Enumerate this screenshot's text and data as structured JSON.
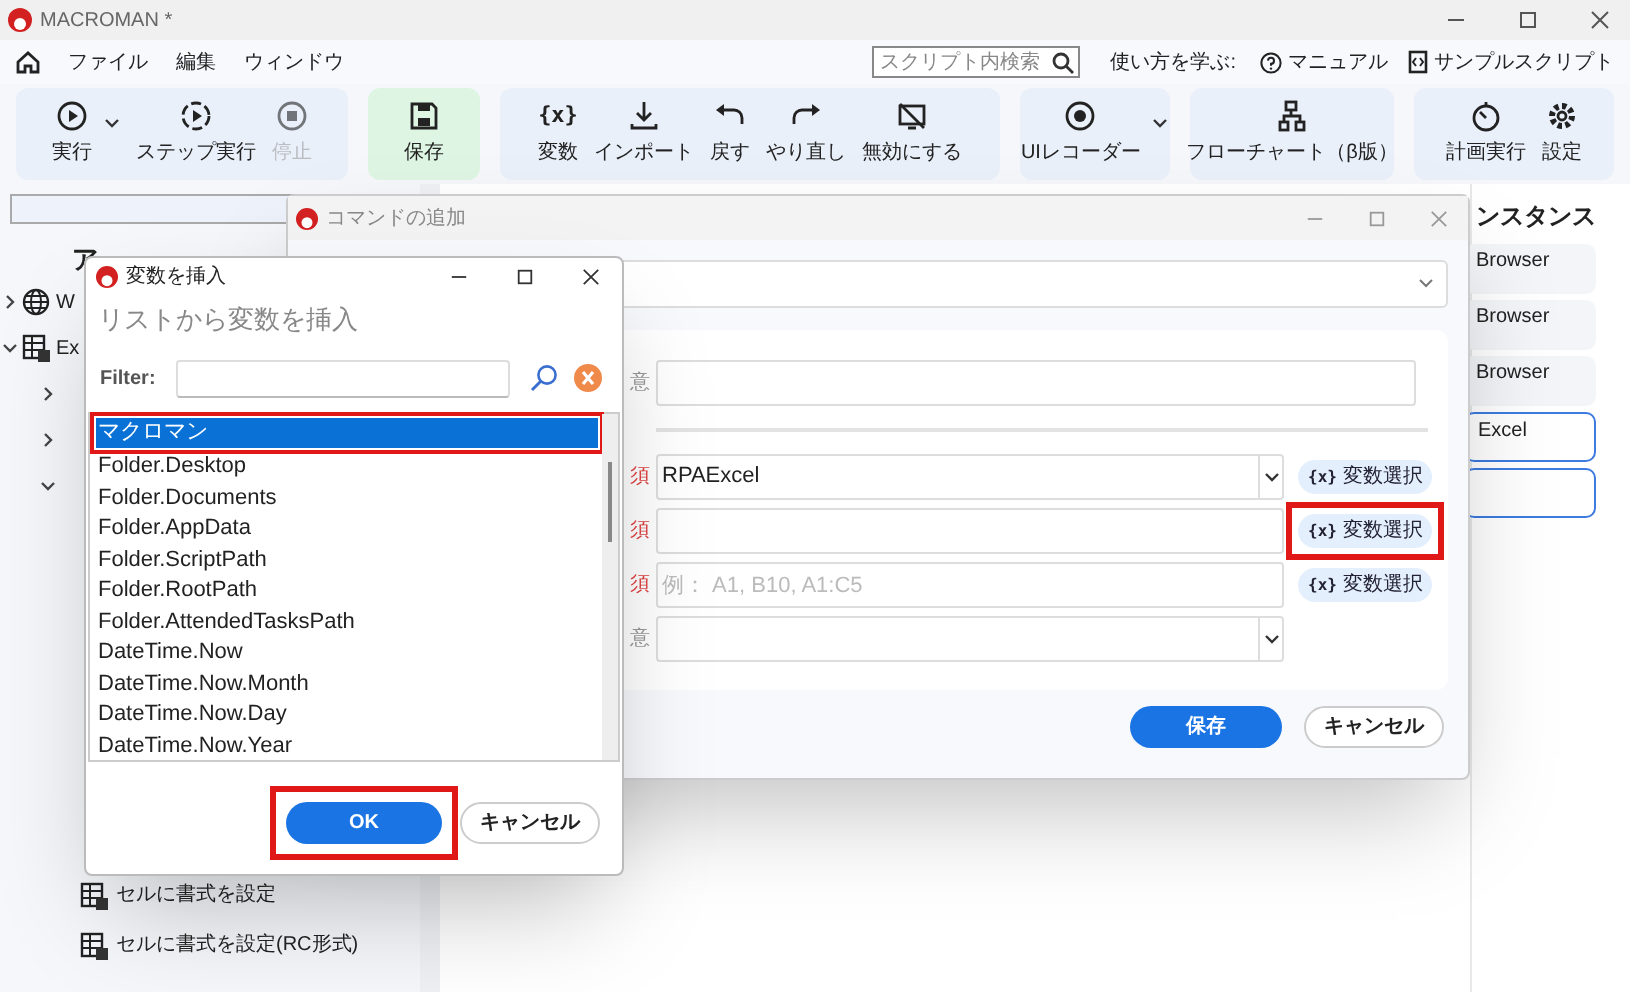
{
  "app": {
    "title": "MACROMAN *"
  },
  "menu": [
    {
      "label": "ファイル"
    },
    {
      "label": "編集"
    },
    {
      "label": "ウィンドウ"
    }
  ],
  "search": {
    "placeholder": "スクリプト内検索"
  },
  "learn": {
    "label": "使い方を学ぶ:",
    "links": [
      {
        "label": "マニュアル"
      },
      {
        "label": "サンプルスクリプト"
      }
    ]
  },
  "toolbar": [
    {
      "kind": "plain",
      "buttons": [
        {
          "label": "実行",
          "dropdown": true,
          "disabled": false
        },
        {
          "label": "ステップ実行",
          "dropdown": false,
          "disabled": false
        },
        {
          "label": "停止",
          "dropdown": false,
          "disabled": true
        }
      ]
    },
    {
      "kind": "accent",
      "buttons": [
        {
          "label": "保存",
          "dropdown": false,
          "disabled": false
        }
      ]
    },
    {
      "kind": "plain",
      "buttons": [
        {
          "label": "変数",
          "glyph": "{x}",
          "dropdown": false,
          "disabled": false
        },
        {
          "label": "インポート",
          "dropdown": false,
          "disabled": false
        },
        {
          "label": "戻す",
          "dropdown": false,
          "disabled": false
        },
        {
          "label": "やり直し",
          "dropdown": false,
          "disabled": false
        },
        {
          "label": "無効にする",
          "dropdown": false,
          "disabled": false
        }
      ]
    },
    {
      "kind": "plain",
      "buttons": [
        {
          "label": "UIレコーダー",
          "dropdown": true,
          "disabled": false
        }
      ]
    },
    {
      "kind": "plain",
      "buttons": [
        {
          "label": "フローチャート（β版）",
          "dropdown": false,
          "disabled": false
        }
      ]
    },
    {
      "kind": "plain",
      "buttons": [
        {
          "label": "計画実行",
          "dropdown": false,
          "disabled": false
        },
        {
          "label": "設定",
          "dropdown": false,
          "disabled": false
        }
      ]
    }
  ],
  "side_panel": {
    "header": "ア",
    "tree": [
      {
        "label": "W",
        "kind": "web",
        "expanded": false
      },
      {
        "label": "Ex",
        "kind": "excel",
        "expanded": true,
        "children": [
          {
            "expanded": false
          },
          {
            "expanded": false
          },
          {
            "expanded": true
          }
        ]
      }
    ],
    "actions": [
      {
        "label": "セルに書式を設定"
      },
      {
        "label": "セルに書式を設定(RC形式)"
      }
    ]
  },
  "instances": {
    "header": "ンスタンス",
    "items": [
      {
        "label": "Browser",
        "selected": false
      },
      {
        "label": "Browser",
        "selected": false
      },
      {
        "label": "Browser",
        "selected": false
      },
      {
        "label": "Excel",
        "selected": true
      },
      {
        "selected": true
      }
    ]
  },
  "command_dialog": {
    "title": "コマンドの追加",
    "fields": [
      {
        "kind": "text",
        "label": "意"
      },
      {
        "kind": "combo",
        "label": "須",
        "value": "RPAExcel",
        "variable_button": {
          "icon": "{x}",
          "label": "変数選択",
          "highlighted": false
        }
      },
      {
        "kind": "text",
        "label": "須",
        "variable_button": {
          "icon": "{x}",
          "label": "変数選択",
          "highlighted": true
        }
      },
      {
        "kind": "text",
        "label": "須",
        "placeholder": "例： A1, B10, A1:C5",
        "variable_button": {
          "icon": "{x}",
          "label": "変数選択",
          "highlighted": false
        }
      },
      {
        "kind": "combo",
        "label": "意"
      }
    ],
    "buttons": [
      {
        "label": "保存",
        "primary": true
      },
      {
        "label": "キャンセル",
        "primary": false
      }
    ]
  },
  "variable_dialog": {
    "title": "変数を挿入",
    "heading": "リストから変数を挿入",
    "filter_label": "Filter:",
    "items": [
      {
        "label": "マクロマン",
        "selected": true,
        "highlighted": true
      },
      {
        "label": "Folder.Desktop",
        "selected": false,
        "highlighted": false
      },
      {
        "label": "Folder.Documents",
        "selected": false,
        "highlighted": false
      },
      {
        "label": "Folder.AppData",
        "selected": false,
        "highlighted": false
      },
      {
        "label": "Folder.ScriptPath",
        "selected": false,
        "highlighted": false
      },
      {
        "label": "Folder.RootPath",
        "selected": false,
        "highlighted": false
      },
      {
        "label": "Folder.AttendedTasksPath",
        "selected": false,
        "highlighted": false
      },
      {
        "label": "DateTime.Now",
        "selected": false,
        "highlighted": false
      },
      {
        "label": "DateTime.Now.Month",
        "selected": false,
        "highlighted": false
      },
      {
        "label": "DateTime.Now.Day",
        "selected": false,
        "highlighted": false
      },
      {
        "label": "DateTime.Now.Year",
        "selected": false,
        "highlighted": false
      }
    ],
    "buttons": [
      {
        "label": "OK",
        "primary": true,
        "highlighted": true
      },
      {
        "label": "キャンセル",
        "primary": false,
        "highlighted": false
      }
    ]
  }
}
